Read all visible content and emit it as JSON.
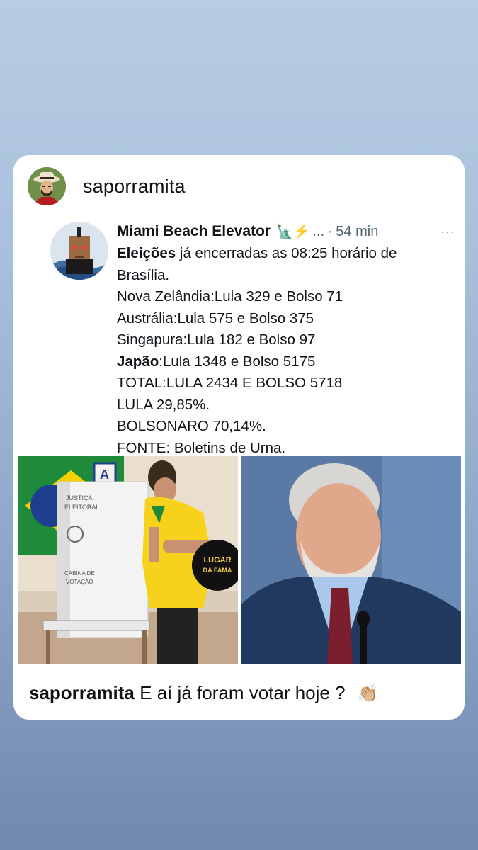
{
  "story": {
    "username": "saporramita",
    "caption_user": "saporramita",
    "caption_text": "E aí já foram votar hoje ?",
    "caption_emoji": "👏🏼"
  },
  "tweet": {
    "author": "Miami Beach Elevator",
    "emoji": "🗽⚡",
    "ellipsis": "...",
    "time": "· 54 min",
    "more": "···",
    "line1_bold": "Eleições",
    "line1_rest": " já encerradas as 08:25 horário de",
    "line2": "Brasília.",
    "line3": "Nova Zelândia:Lula 329 e Bolso 71",
    "line4": "Austrália:Lula 575 e Bolso 375",
    "line5": "Singapura:Lula 182 e Bolso 97",
    "line6_bold": "Japão",
    "line6_rest": ":Lula 1348 e Bolso 5175",
    "line7": "TOTAL:LULA 2434 E BOLSO 5718",
    "line8": "LULA 29,85%.",
    "line9": "BOLSONARO 70,14%.",
    "line10": "FONTE: Boletins de Urna."
  },
  "image": {
    "booth_line1": "JUSTIÇA",
    "booth_line2": "ELEITORAL",
    "booth_line3": "CABINA DE",
    "booth_line4": "VOTAÇÃO",
    "watermark_line1": "LUGAR",
    "watermark_line2": "DA FAMA"
  },
  "colors": {
    "background_top": "#b7cde4",
    "background_bottom": "#6f89af",
    "card": "#ffffff",
    "brazil_green": "#1f8a3a",
    "brazil_yellow": "#f2d300",
    "suit_navy": "#22395f"
  }
}
